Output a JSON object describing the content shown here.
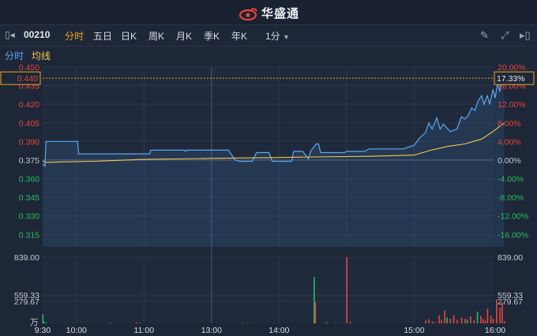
{
  "app": {
    "brand": "华盛通"
  },
  "toolbar": {
    "stock_code": "00210",
    "tabs": [
      "分时",
      "五日",
      "日K",
      "周K",
      "月K",
      "季K",
      "年K"
    ],
    "active_tab": "分时",
    "interval": "1分"
  },
  "legend": {
    "line_label": "分时",
    "avg_label": "均线"
  },
  "colors": {
    "up": "#e8453c",
    "down": "#2dbb5c",
    "line": "#5aa8f0",
    "avg": "#f2c94c",
    "accent": "#f5a623"
  },
  "price_axis": {
    "left_labels": [
      "0.450",
      "0.435",
      "0.420",
      "0.405",
      "0.390",
      "0.375",
      "0.360",
      "0.345",
      "0.330",
      "0.315"
    ],
    "right_labels": [
      "20.00%",
      "16.00%",
      "12.00%",
      "8.00%",
      "4.00%",
      "0.00%",
      "-4.00%",
      "-8.00%",
      "-12.00%",
      "-16.00%"
    ],
    "current_price": "0.440",
    "current_change": "17.33%"
  },
  "volume_axis": {
    "labels": [
      "839.00",
      "559.33",
      "279.67"
    ],
    "unit": "万"
  },
  "time_axis": [
    "9:30",
    "10:00",
    "11:00",
    "13:00",
    "14:00",
    "15:00",
    "16:00"
  ],
  "chart_data": {
    "type": "line",
    "prev_close": 0.375,
    "ylim": [
      0.305,
      0.45
    ],
    "x_range_minutes": [
      0,
      390
    ],
    "price_series": [
      [
        0,
        0.372
      ],
      [
        2,
        0.37
      ],
      [
        3,
        0.39
      ],
      [
        31,
        0.39
      ],
      [
        32,
        0.38
      ],
      [
        95,
        0.38
      ],
      [
        96,
        0.383
      ],
      [
        126,
        0.383
      ],
      [
        127,
        0.382
      ],
      [
        128,
        0.383
      ],
      [
        144,
        0.383
      ],
      [
        150,
        0.383
      ],
      [
        165,
        0.383
      ],
      [
        171,
        0.375
      ],
      [
        175,
        0.374
      ],
      [
        186,
        0.374
      ],
      [
        190,
        0.381
      ],
      [
        201,
        0.381
      ],
      [
        204,
        0.374
      ],
      [
        221,
        0.374
      ],
      [
        223,
        0.382
      ],
      [
        231,
        0.382
      ],
      [
        236,
        0.376
      ],
      [
        238,
        0.382
      ],
      [
        243,
        0.388
      ],
      [
        245,
        0.388
      ],
      [
        247,
        0.381
      ],
      [
        268,
        0.381
      ],
      [
        270,
        0.382
      ],
      [
        286,
        0.382
      ],
      [
        290,
        0.384
      ],
      [
        320,
        0.384
      ],
      [
        330,
        0.387
      ],
      [
        335,
        0.393
      ],
      [
        340,
        0.397
      ],
      [
        343,
        0.405
      ],
      [
        346,
        0.4
      ],
      [
        350,
        0.409
      ],
      [
        353,
        0.4
      ],
      [
        356,
        0.404
      ],
      [
        362,
        0.398
      ],
      [
        368,
        0.4
      ],
      [
        372,
        0.41
      ],
      [
        375,
        0.408
      ],
      [
        378,
        0.411
      ],
      [
        381,
        0.417
      ],
      [
        384,
        0.415
      ],
      [
        387,
        0.423
      ],
      [
        390,
        0.427
      ],
      [
        392,
        0.42
      ],
      [
        395,
        0.427
      ],
      [
        397,
        0.42
      ],
      [
        400,
        0.432
      ],
      [
        402,
        0.425
      ],
      [
        404,
        0.437
      ],
      [
        406,
        0.43
      ],
      [
        408,
        0.44
      ],
      [
        410,
        0.441
      ]
    ],
    "avg_series": [
      [
        0,
        0.3745
      ],
      [
        2,
        0.373
      ],
      [
        15,
        0.3735
      ],
      [
        45,
        0.374
      ],
      [
        90,
        0.3755
      ],
      [
        160,
        0.3765
      ],
      [
        205,
        0.377
      ],
      [
        240,
        0.3775
      ],
      [
        290,
        0.378
      ],
      [
        330,
        0.379
      ],
      [
        345,
        0.383
      ],
      [
        360,
        0.386
      ],
      [
        375,
        0.388
      ],
      [
        390,
        0.392
      ],
      [
        400,
        0.398
      ],
      [
        410,
        0.405
      ]
    ],
    "volume_ylim": [
      0,
      880
    ],
    "volume_series": [
      [
        0,
        120,
        1
      ],
      [
        1,
        25,
        1
      ],
      [
        3,
        12,
        1
      ],
      [
        8,
        4,
        1
      ],
      [
        20,
        3,
        1
      ],
      [
        27,
        6,
        1
      ],
      [
        60,
        9,
        0
      ],
      [
        83,
        14,
        0
      ],
      [
        86,
        10,
        0
      ],
      [
        178,
        8,
        1
      ],
      [
        182,
        6,
        0
      ],
      [
        205,
        3,
        0
      ],
      [
        241,
        615,
        1
      ],
      [
        242,
        280,
        0
      ],
      [
        252,
        14,
        1
      ],
      [
        260,
        5,
        1
      ],
      [
        270,
        880,
        0
      ],
      [
        273,
        22,
        0
      ],
      [
        340,
        40,
        0
      ],
      [
        343,
        55,
        0
      ],
      [
        346,
        25,
        0
      ],
      [
        348,
        15,
        0
      ],
      [
        352,
        105,
        0
      ],
      [
        354,
        48,
        0
      ],
      [
        357,
        170,
        0
      ],
      [
        359,
        78,
        1
      ],
      [
        362,
        62,
        0
      ],
      [
        365,
        110,
        0
      ],
      [
        368,
        45,
        0
      ],
      [
        372,
        75,
        0
      ],
      [
        375,
        60,
        0
      ],
      [
        377,
        50,
        1
      ],
      [
        380,
        92,
        0
      ],
      [
        383,
        40,
        0
      ],
      [
        386,
        155,
        1
      ],
      [
        389,
        98,
        0
      ],
      [
        391,
        58,
        0
      ],
      [
        393,
        36,
        0
      ],
      [
        395,
        195,
        0
      ],
      [
        398,
        102,
        0
      ],
      [
        400,
        60,
        0
      ],
      [
        403,
        320,
        0
      ],
      [
        406,
        210,
        0
      ],
      [
        408,
        280,
        0
      ],
      [
        410,
        30,
        0
      ]
    ]
  }
}
